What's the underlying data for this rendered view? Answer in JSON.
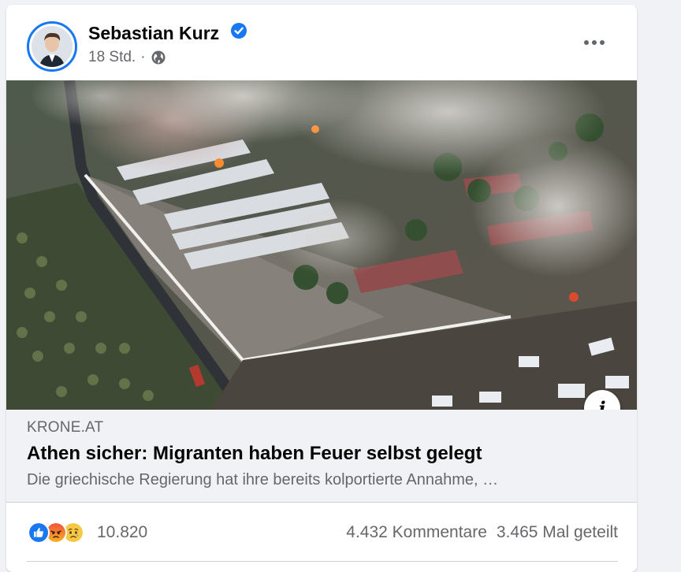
{
  "post": {
    "author_name": "Sebastian Kurz",
    "time": "18 Std.",
    "separator": "·",
    "privacy_icon": "globe-icon",
    "verified_icon": "verified-badge-icon",
    "more_icon": "more-options-icon"
  },
  "link": {
    "domain": "KRONE.AT",
    "headline": "Athen sicher: Migranten haben Feuer selbst gelegt",
    "description": "Die griechische Regierung hat ihre bereits kolportierte Annahme, …",
    "info_label": "i"
  },
  "engagement": {
    "reactions": [
      "like-icon",
      "angry-icon",
      "sad-icon"
    ],
    "reaction_count": "10.820",
    "comments": "4.432 Kommentare",
    "shares": "3.465 Mal geteilt"
  },
  "colors": {
    "accent": "#1877f2",
    "secondary_text": "#65676b",
    "link_background": "#f0f2f5",
    "angry": "#e9710f",
    "sad": "#f7b125"
  }
}
